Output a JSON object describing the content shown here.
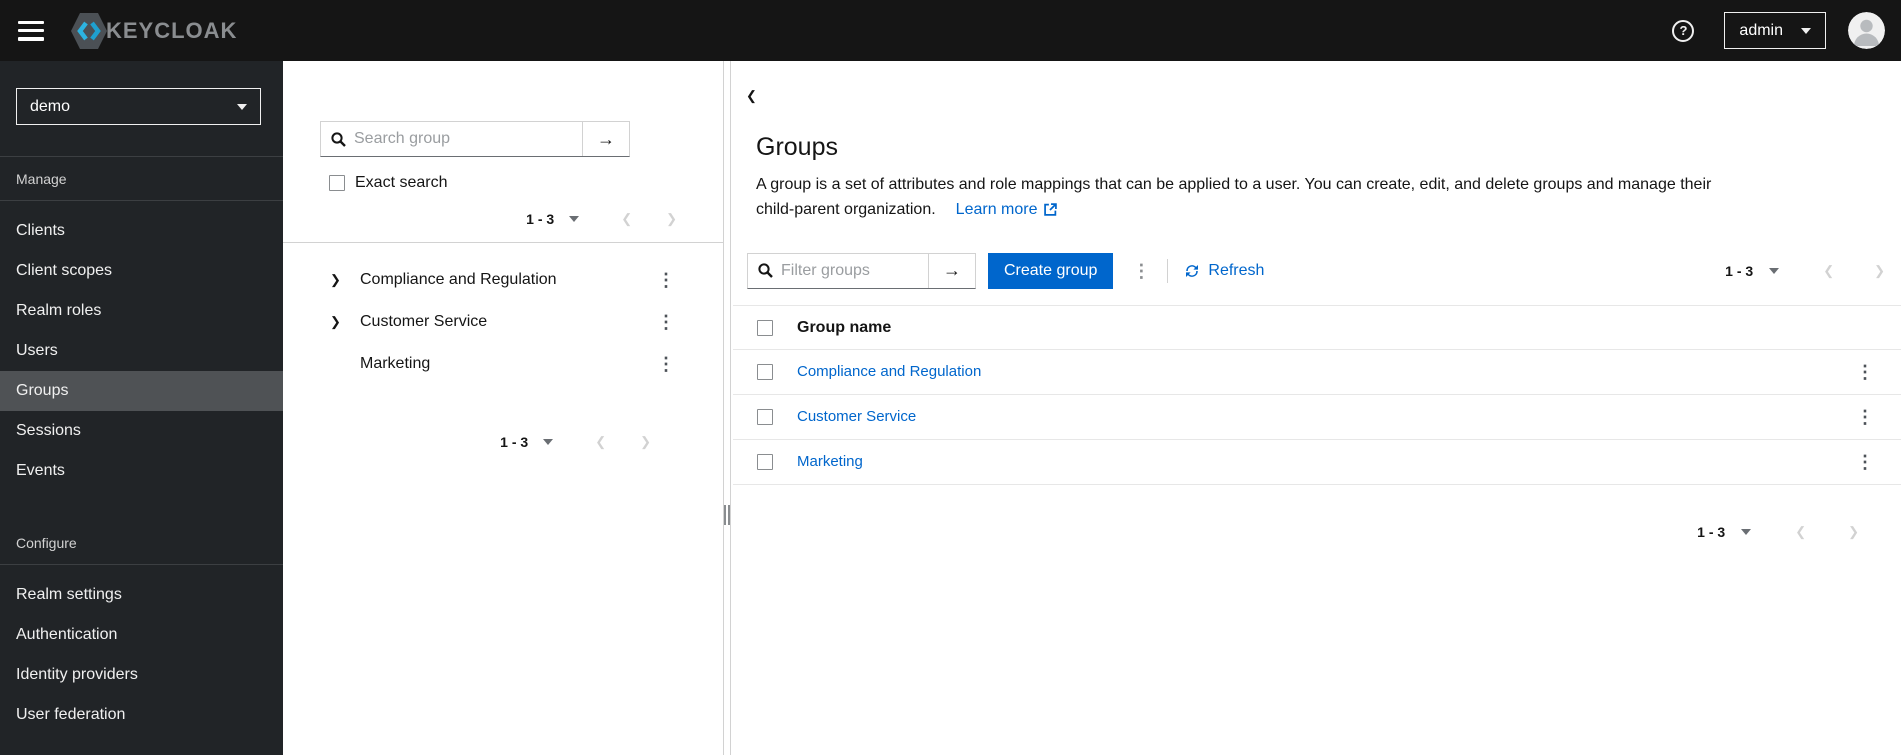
{
  "masthead": {
    "brand": "KEYCLOAK",
    "user": "admin"
  },
  "sidebar": {
    "realm": "demo",
    "manage_title": "Manage",
    "manage_items": [
      "Clients",
      "Client scopes",
      "Realm roles",
      "Users",
      "Groups",
      "Sessions",
      "Events"
    ],
    "active_item": "Groups",
    "configure_title": "Configure",
    "configure_items": [
      "Realm settings",
      "Authentication",
      "Identity providers",
      "User federation"
    ]
  },
  "tree_panel": {
    "search_placeholder": "Search group",
    "exact_search_label": "Exact search",
    "pagination_range": "1 - 3",
    "items": [
      {
        "name": "Compliance and Regulation",
        "expandable": true
      },
      {
        "name": "Customer Service",
        "expandable": true
      },
      {
        "name": "Marketing",
        "expandable": false
      }
    ]
  },
  "main": {
    "title": "Groups",
    "description_line1": "A group is a set of attributes and role mappings that can be applied to a user. You can create, edit, and delete groups and manage their",
    "description_line2": "child-parent organization.",
    "learn_more_label": "Learn more",
    "filter_placeholder": "Filter groups",
    "create_button_label": "Create group",
    "refresh_label": "Refresh",
    "pagination_range": "1 - 3",
    "table": {
      "header": "Group name",
      "rows": [
        "Compliance and Regulation",
        "Customer Service",
        "Marketing"
      ]
    }
  },
  "icons": {
    "kebab": "⋮",
    "chevron_right": "❯",
    "back": "❮",
    "arrow_right": "→",
    "help": "?",
    "prev": "❮",
    "next": "❯"
  },
  "colors": {
    "accent": "#0066cc",
    "masthead_bg": "#151515",
    "sidebar_bg": "#212427",
    "sidebar_active_bg": "#4f5255",
    "link": "#0066cc",
    "border": "#d2d2d2"
  }
}
